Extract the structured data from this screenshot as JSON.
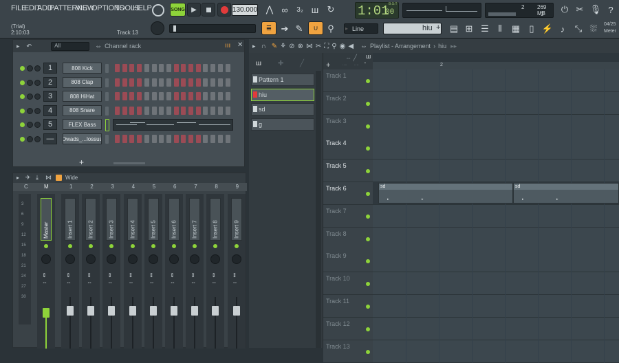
{
  "menu": [
    "FILE",
    "EDIT",
    "ADD",
    "PATTERNS",
    "VIEW",
    "OPTIONS",
    "TOOLS",
    "HELP"
  ],
  "trial": "(Trial)",
  "time_small": "2:10:03",
  "hint_track": "Track 13",
  "transport": {
    "mode": "SONG",
    "tempo": "130.000",
    "song_time": "1:01",
    "song_time_sub": "00",
    "time_label": "B:S:T"
  },
  "cpu": {
    "mem": "269 MB",
    "num1": "2",
    "num2": "0"
  },
  "snap": "Line",
  "pattern_name": "hiu",
  "meter": {
    "date": "04/25",
    "label": "Meter"
  },
  "rack": {
    "title": "Channel rack",
    "filter": "All",
    "channels": [
      {
        "num": "1",
        "name": "808 Kick"
      },
      {
        "num": "2",
        "name": "808 Clap"
      },
      {
        "num": "3",
        "name": "808 HiHat"
      },
      {
        "num": "4",
        "name": "808 Snare"
      },
      {
        "num": "5",
        "name": "FLEX Bass"
      },
      {
        "num": "—",
        "name": "Dwads_...lossus"
      }
    ],
    "add": "+"
  },
  "mixer": {
    "title": "Wide",
    "col_c": "C",
    "col_m": "M",
    "strips": [
      "Master",
      "Insert 1",
      "Insert 2",
      "Insert 3",
      "Insert 4",
      "Insert 5",
      "Insert 6",
      "Insert 7",
      "Insert 8",
      "Insert 9"
    ],
    "nums": [
      "1",
      "2",
      "3",
      "4",
      "5",
      "6",
      "7",
      "8",
      "9"
    ],
    "scale": [
      "3",
      "6",
      "9",
      "12",
      "15",
      "18",
      "21",
      "24",
      "27",
      "30"
    ]
  },
  "playlist": {
    "title": "Playlist - Arrangement",
    "crumb": "hiu",
    "patterns": [
      "Pattern 1",
      "hiu",
      "sd",
      "g"
    ],
    "tracks": [
      "Track 1",
      "Track 2",
      "Track 3",
      "Track 4",
      "Track 5",
      "Track 6",
      "Track 7",
      "Track 8",
      "Track 9",
      "Track 10",
      "Track 11",
      "Track 12",
      "Track 13"
    ],
    "bar_marker": "2",
    "clip_name": "sd"
  },
  "colors": {
    "accent_green": "#8ed33a",
    "orange": "#f0a340",
    "step_red": "#9b4b55"
  }
}
